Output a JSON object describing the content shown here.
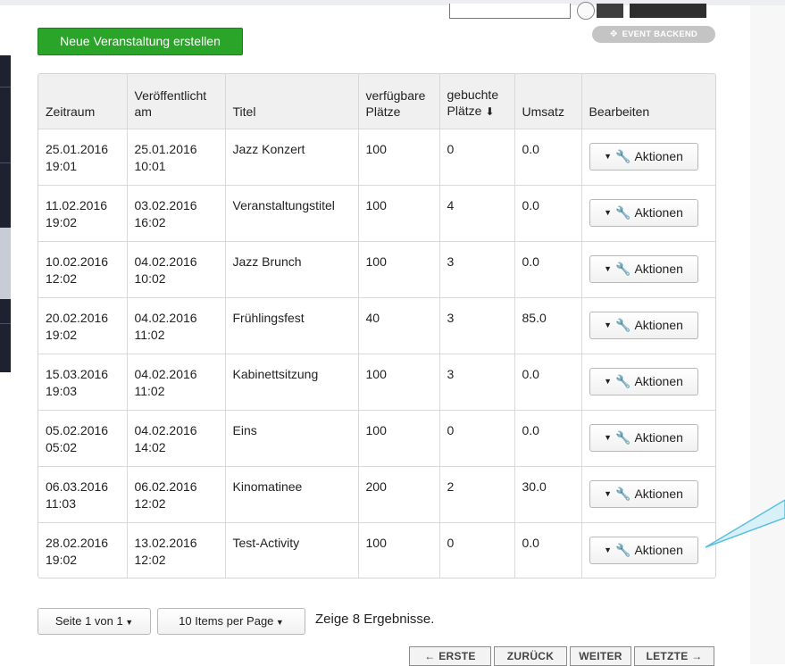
{
  "toolbar": {
    "new_event_label": "Neue Veranstaltung erstellen",
    "event_backend_label": "EVENT BACKEND",
    "event_backend_icon": "move-icon"
  },
  "table": {
    "headers": {
      "zeitraum": "Zeitraum",
      "veroeffentlicht_1": "Veröffentlicht",
      "veroeffentlicht_2": "am",
      "titel": "Titel",
      "plaetze_1": "verfügbare",
      "plaetze_2": "Plätze",
      "gebucht_1": "gebuchte",
      "gebucht_2": "Plätze",
      "umsatz": "Umsatz",
      "bearbeiten": "Bearbeiten"
    },
    "rows": [
      {
        "zeitraum_date": "25.01.2016",
        "zeitraum_time": "19:01",
        "pub_date": "25.01.2016",
        "pub_time": "10:01",
        "titel": "Jazz Konzert",
        "verfuegbar": "100",
        "gebucht": "0",
        "umsatz": "0.0",
        "action": "Aktionen"
      },
      {
        "zeitraum_date": "11.02.2016",
        "zeitraum_time": "19:02",
        "pub_date": "03.02.2016",
        "pub_time": "16:02",
        "titel": "Veranstaltungstitel",
        "verfuegbar": "100",
        "gebucht": "4",
        "umsatz": "0.0",
        "action": "Aktionen"
      },
      {
        "zeitraum_date": "10.02.2016",
        "zeitraum_time": "12:02",
        "pub_date": "04.02.2016",
        "pub_time": "10:02",
        "titel": "Jazz Brunch",
        "verfuegbar": "100",
        "gebucht": "3",
        "umsatz": "0.0",
        "action": "Aktionen"
      },
      {
        "zeitraum_date": "20.02.2016",
        "zeitraum_time": "19:02",
        "pub_date": "04.02.2016",
        "pub_time": "11:02",
        "titel": "Frühlingsfest",
        "verfuegbar": "40",
        "gebucht": "3",
        "umsatz": "85.0",
        "action": "Aktionen"
      },
      {
        "zeitraum_date": "15.03.2016",
        "zeitraum_time": "19:03",
        "pub_date": "04.02.2016",
        "pub_time": "11:02",
        "titel": "Kabinettsitzung",
        "verfuegbar": "100",
        "gebucht": "3",
        "umsatz": "0.0",
        "action": "Aktionen"
      },
      {
        "zeitraum_date": "05.02.2016",
        "zeitraum_time": "05:02",
        "pub_date": "04.02.2016",
        "pub_time": "14:02",
        "titel": "Eins",
        "verfuegbar": "100",
        "gebucht": "0",
        "umsatz": "0.0",
        "action": "Aktionen"
      },
      {
        "zeitraum_date": "06.03.2016",
        "zeitraum_time": "11:03",
        "pub_date": "06.02.2016",
        "pub_time": "12:02",
        "titel": "Kinomatinee",
        "verfuegbar": "200",
        "gebucht": "2",
        "umsatz": "30.0",
        "action": "Aktionen"
      },
      {
        "zeitraum_date": "28.02.2016",
        "zeitraum_time": "19:02",
        "pub_date": "13.02.2016",
        "pub_time": "12:02",
        "titel": "Test-Activity",
        "verfuegbar": "100",
        "gebucht": "0",
        "umsatz": "0.0",
        "action": "Aktionen"
      }
    ]
  },
  "pagination": {
    "page_select": "Seite 1 von 1",
    "per_page_select": "10 Items per Page",
    "results_text": "Zeige 8 Ergebnisse.",
    "first": "← ERSTE",
    "prev": "ZURÜCK",
    "next": "WEITER",
    "last": "LETZTE →"
  },
  "colors": {
    "primary_green": "#2aa52a",
    "callout_blue": "#5bc0de",
    "wrench_orange": "#e08a1e"
  }
}
